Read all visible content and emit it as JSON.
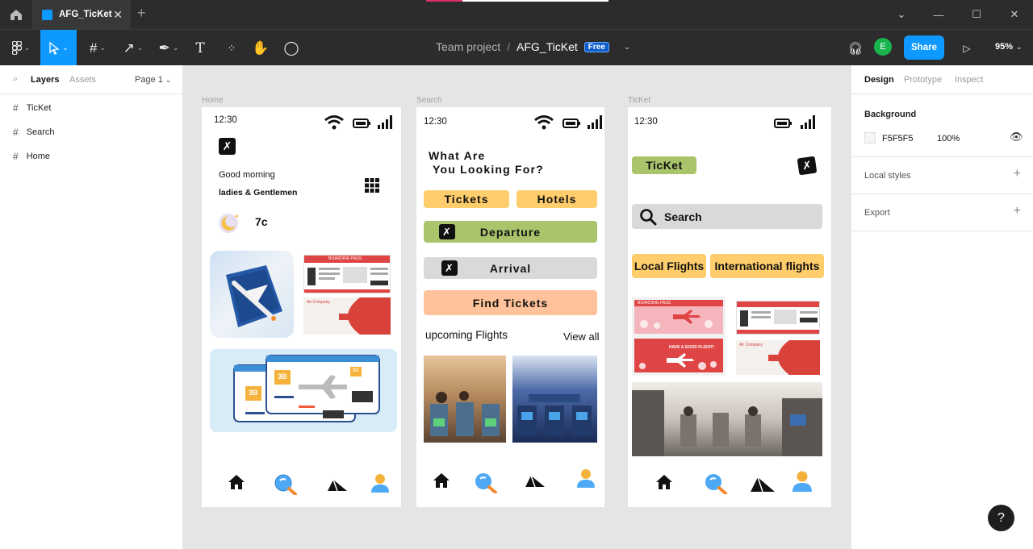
{
  "titlebar": {
    "file_tab": "AFG_TicKet",
    "new_tab": "+"
  },
  "toolbar": {
    "breadcrumb_team": "Team project",
    "breadcrumb_sep": "/",
    "breadcrumb_file": "AFG_TicKet",
    "badge": "Free",
    "avatar": "E",
    "share_label": "Share",
    "zoom": "95%"
  },
  "left_panel": {
    "tab_layers": "Layers",
    "tab_assets": "Assets",
    "page": "Page 1",
    "layers": [
      "TicKet",
      "Search",
      "Home"
    ]
  },
  "right_panel": {
    "tab_design": "Design",
    "tab_prototype": "Prototype",
    "tab_inspect": "Inspect",
    "background_title": "Background",
    "background_hex": "F5F5F5",
    "background_opacity": "100%",
    "local_styles": "Local styles",
    "export": "Export"
  },
  "colors": {
    "accent": "#0d99ff",
    "yellow": "#ffcd6b",
    "green": "#a9c46b",
    "peach": "#ffc29a",
    "grey": "#d9d9d9"
  },
  "home": {
    "label": "Home",
    "time": "12:30",
    "greeting": "Good morning",
    "subgreeting": "ladies & Gentlemen",
    "temperature": "7c",
    "seat_a": "3B",
    "seat_b": "3B",
    "seat_c": "3C",
    "boarding": "BOARDING PASS",
    "air_company": "Air Company"
  },
  "search": {
    "label": "Search",
    "time": "12:30",
    "heading_line1": "What Are",
    "heading_line2": "You Looking For?",
    "tickets": "Tickets",
    "hotels": "Hotels",
    "departure": "Departure",
    "arrival": "Arrival",
    "find_tickets": "Find Tickets",
    "upcoming": "upcoming Flights",
    "view_all": "View all"
  },
  "ticket": {
    "label": "TicKet",
    "time": "12:30",
    "ticket_pill": "TicKet",
    "search": "Search",
    "local_flights": "Local Flights",
    "international_flights": "International flights",
    "boarding": "BOARDING PASS",
    "have_good": "HAVE A GOOD FLIGHT!",
    "air_company": "Air Company"
  },
  "help": "?"
}
